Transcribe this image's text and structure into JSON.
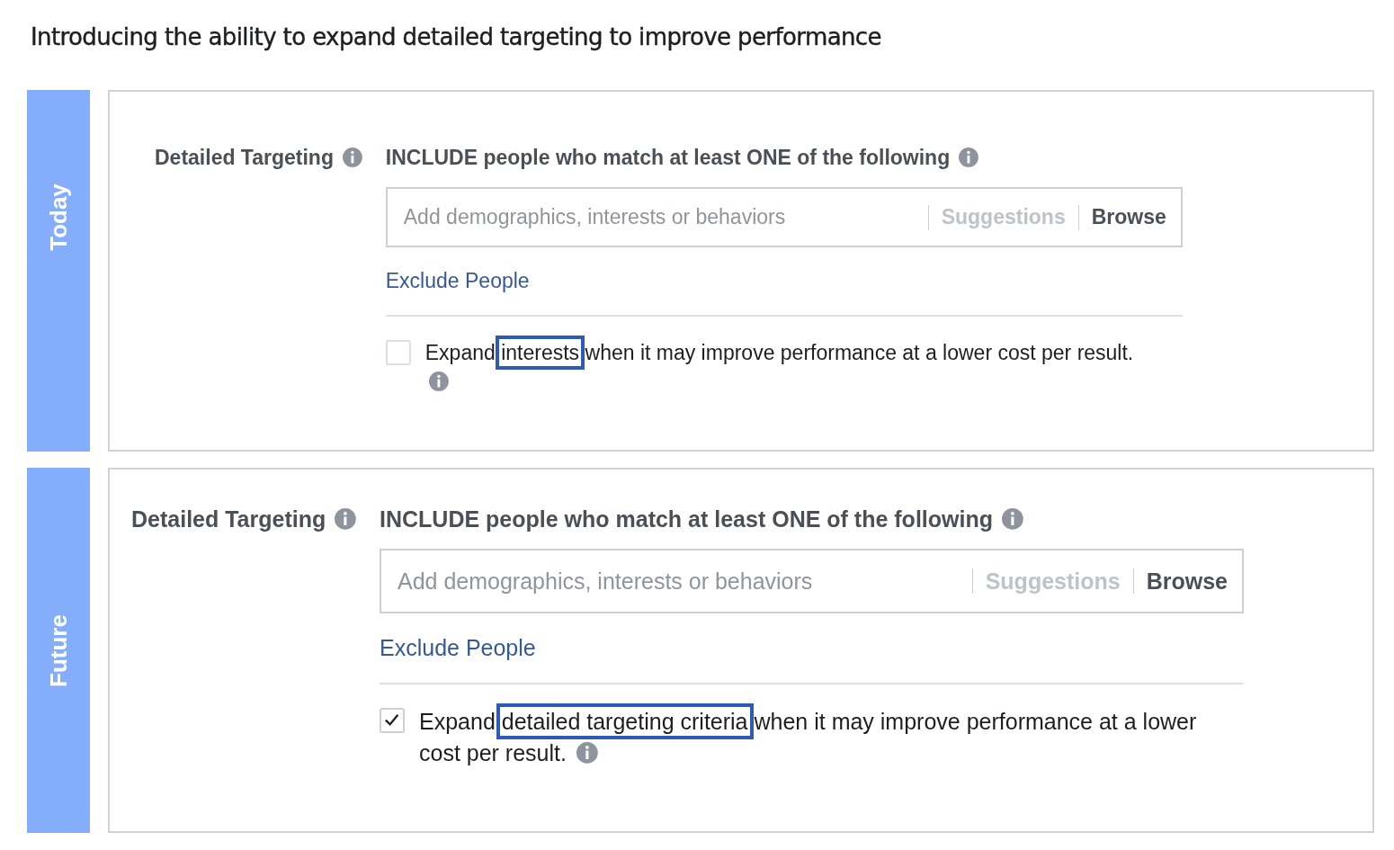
{
  "title": "Introducing the ability to expand detailed targeting to improve performance",
  "panels": [
    {
      "side_label": "Today",
      "label": "Detailed Targeting",
      "include_heading": "INCLUDE people who match at least ONE of the following",
      "search": {
        "placeholder": "Add demographics, interests or behaviors"
      },
      "suggestions": "Suggestions",
      "browse": "Browse",
      "exclude_link": "Exclude People",
      "expand": {
        "checked": false,
        "before": "Expand ",
        "highlight": "interests",
        "after": " when it may improve performance at a lower cost per result."
      }
    },
    {
      "side_label": "Future",
      "label": "Detailed Targeting",
      "include_heading": "INCLUDE people who match at least ONE of the following",
      "search": {
        "placeholder": "Add demographics, interests or behaviors"
      },
      "suggestions": "Suggestions",
      "browse": "Browse",
      "exclude_link": "Exclude People",
      "expand": {
        "checked": true,
        "before": "Expand ",
        "highlight": "detailed targeting criteria",
        "after": " when it may improve performance at a lower cost per result."
      }
    }
  ]
}
